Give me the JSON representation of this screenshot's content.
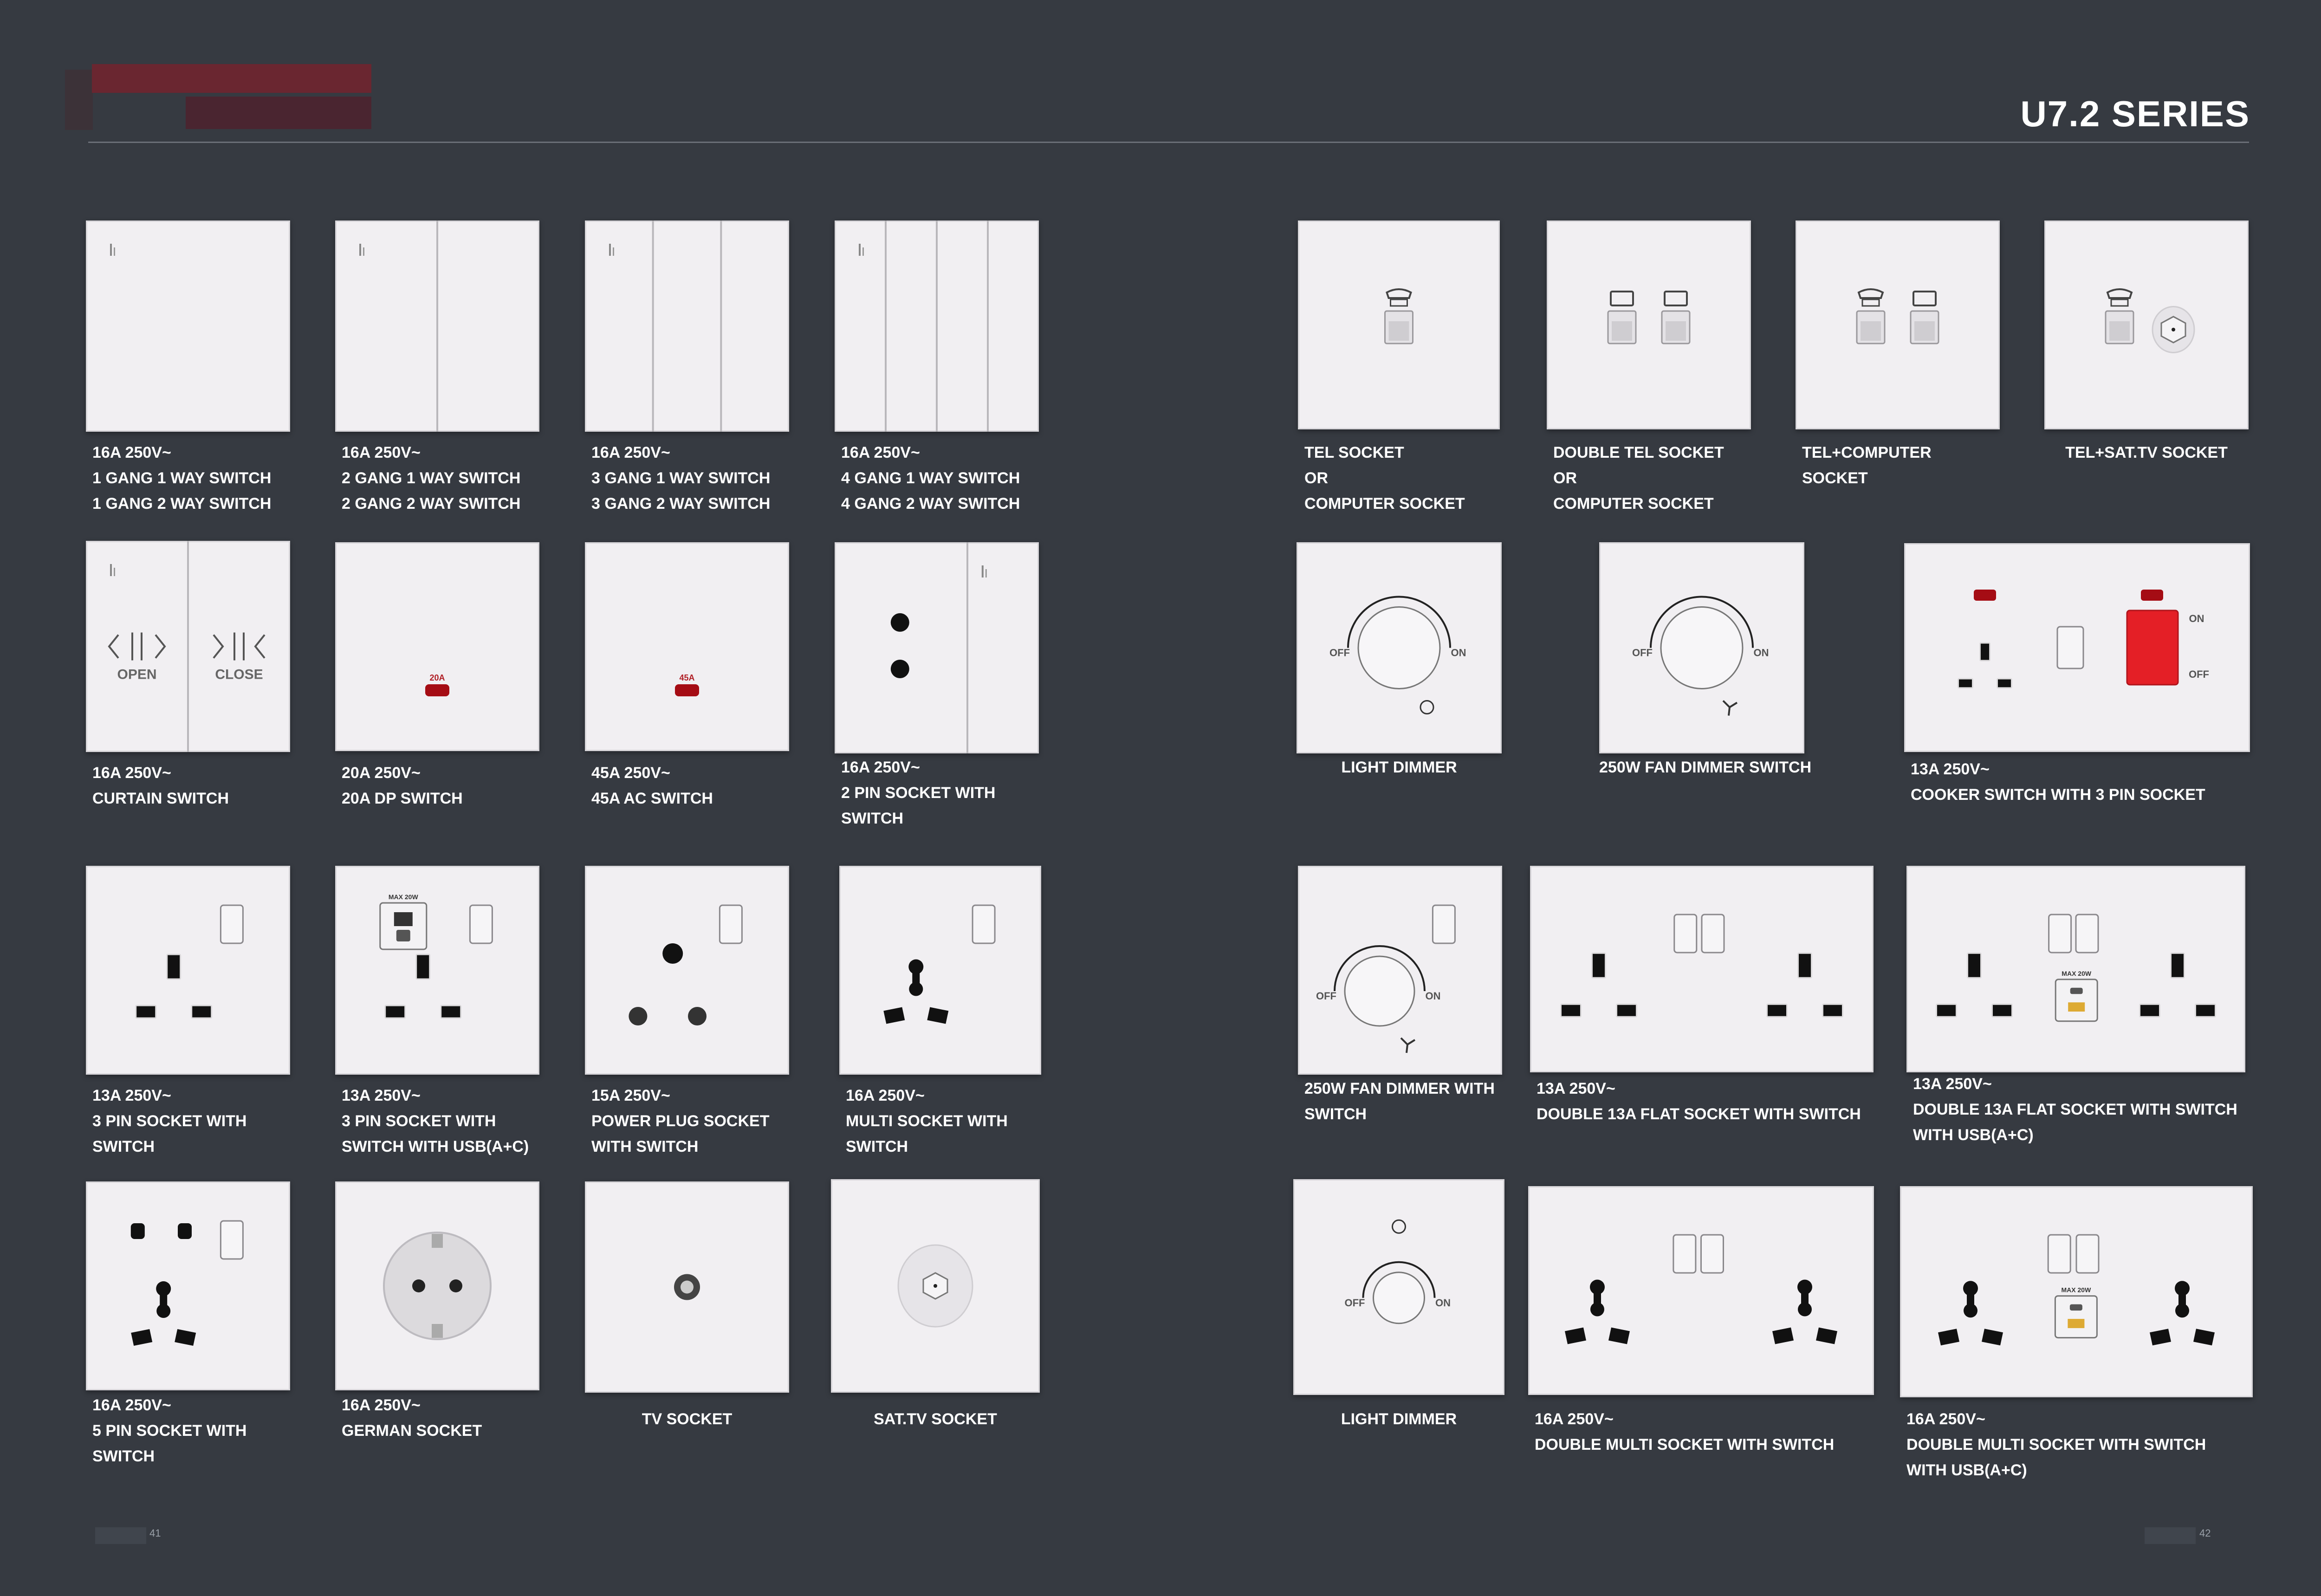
{
  "header": {
    "series_title": "U7.2 SERIES"
  },
  "footer": {
    "left_page": "41",
    "right_page": "42"
  },
  "colors": {
    "background": "#363a41",
    "plate": "#f1eff2",
    "accent_red": "#e41f26",
    "text": "#ffffff"
  },
  "products": [
    {
      "id": "p1",
      "icon": "1-gang-switch",
      "lines": [
        "16A 250V~",
        "1 GANG 1 WAY SWITCH",
        "1 GANG 2 WAY SWITCH"
      ]
    },
    {
      "id": "p2",
      "icon": "2-gang-switch",
      "lines": [
        "16A 250V~",
        "2 GANG 1 WAY SWITCH",
        "2 GANG 2 WAY SWITCH"
      ]
    },
    {
      "id": "p3",
      "icon": "3-gang-switch",
      "lines": [
        "16A 250V~",
        "3 GANG 1 WAY SWITCH",
        "3 GANG 2 WAY SWITCH"
      ]
    },
    {
      "id": "p4",
      "icon": "4-gang-switch",
      "lines": [
        "16A 250V~",
        "4 GANG 1 WAY SWITCH",
        "4 GANG 2 WAY SWITCH"
      ]
    },
    {
      "id": "p5",
      "icon": "tel-socket",
      "lines": [
        "TEL SOCKET",
        "OR",
        "COMPUTER SOCKET"
      ]
    },
    {
      "id": "p6",
      "icon": "double-tel-socket",
      "lines": [
        "DOUBLE TEL SOCKET",
        "OR",
        "COMPUTER SOCKET"
      ]
    },
    {
      "id": "p7",
      "icon": "tel-computer-socket",
      "lines": [
        "TEL+COMPUTER",
        "SOCKET"
      ]
    },
    {
      "id": "p8",
      "icon": "tel-sattv-socket",
      "lines": [
        "TEL+SAT.TV SOCKET"
      ]
    },
    {
      "id": "p9",
      "icon": "curtain-switch",
      "lines": [
        "16A 250V~",
        "CURTAIN SWITCH"
      ],
      "labels": {
        "open": "OPEN",
        "close": "CLOSE"
      }
    },
    {
      "id": "p10",
      "icon": "dp-switch",
      "lines": [
        "20A 250V~",
        "20A DP SWITCH"
      ],
      "rating": "20A"
    },
    {
      "id": "p11",
      "icon": "ac-switch",
      "lines": [
        "45A 250V~",
        "45A AC SWITCH"
      ],
      "rating": "45A"
    },
    {
      "id": "p12",
      "icon": "2-pin-socket",
      "lines": [
        "16A 250V~",
        "2 PIN SOCKET WITH",
        "SWITCH"
      ]
    },
    {
      "id": "p13",
      "icon": "light-dimmer",
      "lines": [
        "LIGHT DIMMER"
      ],
      "labels": {
        "off": "OFF",
        "on": "ON"
      }
    },
    {
      "id": "p14",
      "icon": "fan-dimmer",
      "lines": [
        "250W FAN DIMMER SWITCH"
      ],
      "labels": {
        "off": "OFF",
        "on": "ON"
      }
    },
    {
      "id": "p15",
      "icon": "cooker-switch",
      "lines": [
        "13A 250V~",
        "COOKER SWITCH WITH 3 PIN SOCKET"
      ],
      "labels": {
        "on": "ON",
        "off": "OFF"
      }
    },
    {
      "id": "p16",
      "icon": "3-pin-socket",
      "lines": [
        "13A 250V~",
        "3 PIN SOCKET WITH",
        "SWITCH"
      ]
    },
    {
      "id": "p17",
      "icon": "3-pin-socket-usb",
      "lines": [
        "13A 250V~",
        "3 PIN SOCKET WITH",
        "SWITCH WITH USB(A+C)"
      ],
      "labels": {
        "max": "MAX 20W",
        "usba": "USB-A",
        "usbc": "USB-C"
      }
    },
    {
      "id": "p18",
      "icon": "round-pin-socket",
      "lines": [
        "15A 250V~",
        "POWER PLUG SOCKET",
        "WITH SWITCH"
      ]
    },
    {
      "id": "p19",
      "icon": "multi-socket",
      "lines": [
        "16A 250V~",
        "MULTI SOCKET WITH",
        "SWITCH"
      ]
    },
    {
      "id": "p20",
      "icon": "fan-dimmer-switch",
      "lines": [
        "250W FAN DIMMER WITH",
        "SWITCH"
      ],
      "labels": {
        "off": "OFF",
        "on": "ON"
      }
    },
    {
      "id": "p21",
      "icon": "double-flat-socket",
      "lines": [
        "13A 250V~",
        "DOUBLE 13A FLAT SOCKET WITH SWITCH"
      ]
    },
    {
      "id": "p22",
      "icon": "double-flat-socket-usb",
      "lines": [
        "13A 250V~",
        "DOUBLE 13A FLAT SOCKET WITH SWITCH",
        "WITH USB(A+C)"
      ],
      "labels": {
        "usbc": "USB-C",
        "usba": "USB-A",
        "max": "MAX 20W"
      }
    },
    {
      "id": "p23",
      "icon": "5-pin-socket",
      "lines": [
        "16A 250V~",
        "5 PIN SOCKET WITH",
        "SWITCH"
      ]
    },
    {
      "id": "p24",
      "icon": "german-socket",
      "lines": [
        "16A 250V~",
        "GERMAN SOCKET"
      ]
    },
    {
      "id": "p25",
      "icon": "tv-socket",
      "lines": [
        "TV SOCKET"
      ]
    },
    {
      "id": "p26",
      "icon": "sattv-socket",
      "lines": [
        "SAT.TV SOCKET"
      ]
    },
    {
      "id": "p27",
      "icon": "light-dimmer-v2",
      "lines": [
        "LIGHT DIMMER"
      ],
      "labels": {
        "off": "OFF",
        "on": "ON"
      }
    },
    {
      "id": "p28",
      "icon": "double-multi-socket",
      "lines": [
        "16A 250V~",
        "DOUBLE MULTI SOCKET WITH SWITCH"
      ]
    },
    {
      "id": "p29",
      "icon": "double-multi-socket-usb",
      "lines": [
        "16A 250V~",
        "DOUBLE MULTI SOCKET WITH SWITCH",
        "WITH USB(A+C)"
      ],
      "labels": {
        "usbc": "USB-C",
        "usba": "USB-A",
        "max": "MAX 20W"
      }
    }
  ]
}
